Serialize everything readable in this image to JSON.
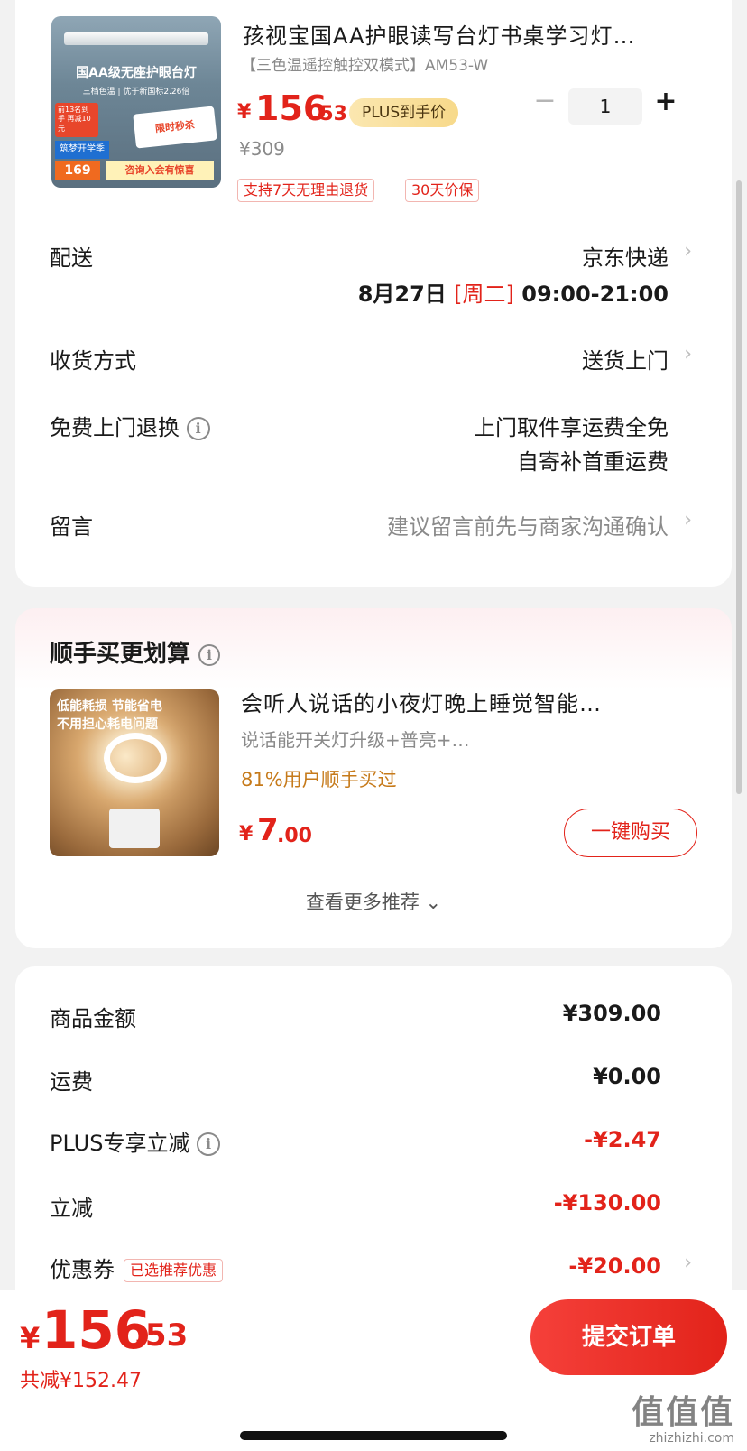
{
  "product": {
    "thumb_text": {
      "headline": "国AA级无座护眼台灯",
      "sub": "三档色温 | 优于新国标2.26倍",
      "promo": "前13名到手 再减10元",
      "flash": "限时秒杀",
      "school": "筑梦开学季",
      "price": "169",
      "consult": "咨询入会有惊喜"
    },
    "title": "孩视宝国AA护眼读写台灯书桌学习灯…",
    "spec": "【三色温遥控触控双模式】AM53-W",
    "price_symbol": "¥",
    "price_int": "156",
    "price_dec": ".53",
    "plus_badge": "PLUS到手价",
    "original_price": "¥309",
    "quantity": "1",
    "qty_minus": "−",
    "qty_plus": "+",
    "tags": [
      "支持7天无理由退货",
      "30天价保"
    ]
  },
  "delivery": {
    "label": "配送",
    "carrier": "京东快递",
    "date": "8月27日",
    "weekday": "[周二]",
    "time": "09:00-21:00"
  },
  "receive": {
    "label": "收货方式",
    "value": "送货上门"
  },
  "free_return": {
    "label": "免费上门退换",
    "line1": "上门取件享运费全免",
    "line2": "自寄补首重运费"
  },
  "message": {
    "label": "留言",
    "placeholder": "建议留言前先与商家沟通确认"
  },
  "chevron": "›",
  "info": "i",
  "recommend": {
    "title": "顺手买更划算",
    "image_caption_1": "低能耗损 节能省电",
    "image_caption_2": "不用担心耗电问题",
    "name": "会听人说话的小夜灯晚上睡觉智能…",
    "spec": "说话能开关灯升级+普亮+…",
    "stat": "81%用户顺手买过",
    "price_symbol": "¥",
    "price_int": "7",
    "price_dec": ".00",
    "buy_label": "一键购买",
    "more_label": "查看更多推荐 ⌄"
  },
  "summary": {
    "goods_label": "商品金额",
    "goods_value": "¥309.00",
    "shipping_label": "运费",
    "shipping_value": "¥0.00",
    "plus_label": "PLUS专享立减",
    "plus_value": "-¥2.47",
    "discount_label": "立减",
    "discount_value": "-¥130.00",
    "coupon_label": "优惠券",
    "coupon_tag": "已选推荐优惠",
    "coupon_value": "-¥20.00"
  },
  "bottom": {
    "total_symbol": "¥",
    "total_int": "156",
    "total_dec": ".53",
    "saved": "共减¥152.47",
    "submit": "提交订单"
  },
  "watermark": {
    "big": "值值值",
    "small": "zhizhizhi.com"
  },
  "colors": {
    "accent": "#e2231a",
    "plus_gold": "#f7d98a",
    "stat_orange": "#c67a1a"
  }
}
